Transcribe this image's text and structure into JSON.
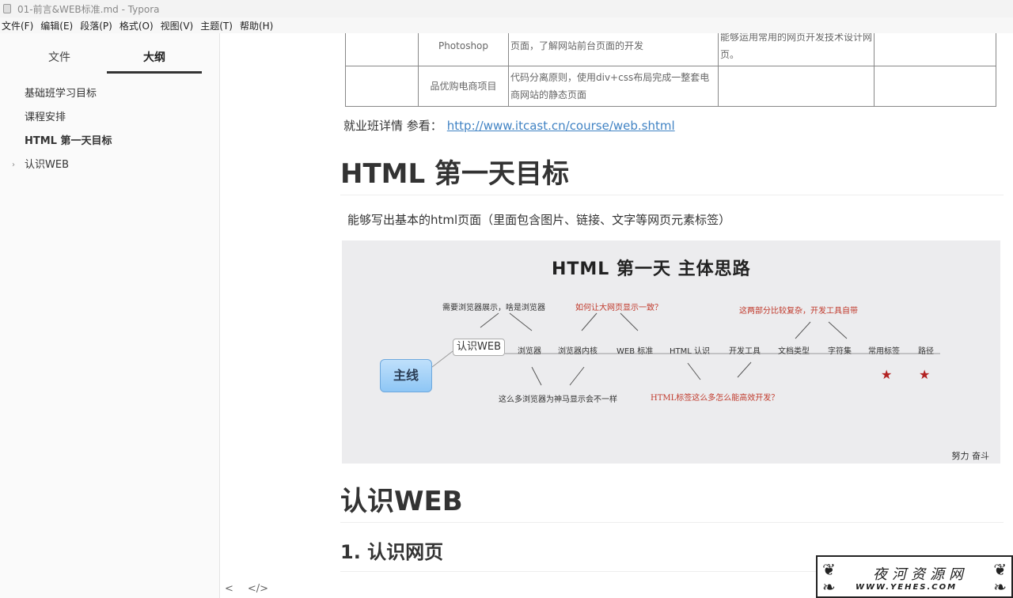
{
  "window": {
    "title": "01-前言&WEB标准.md - Typora"
  },
  "menu": [
    "文件(F)",
    "编辑(E)",
    "段落(P)",
    "格式(O)",
    "视图(V)",
    "主题(T)",
    "帮助(H)"
  ],
  "sidebar": {
    "tabs": [
      {
        "label": "文件"
      },
      {
        "label": "大纲"
      }
    ],
    "outline": [
      {
        "label": "基础班学习目标"
      },
      {
        "label": "课程安排"
      },
      {
        "label": "HTML 第一天目标"
      },
      {
        "label": "认识WEB"
      }
    ],
    "footer": {
      "back": "<",
      "source": "</>"
    }
  },
  "doc": {
    "table": {
      "rows": [
        [
          "",
          "Photoshop",
          "页面，了解网站前台页面的开发",
          "能够运用常用的网页开发技术设计网页。",
          ""
        ],
        [
          "",
          "品优购电商项目",
          "代码分离原则，使用div+css布局完成一整套电商网站的静态页面",
          "",
          ""
        ]
      ]
    },
    "link_prefix": "就业班详情 参看：",
    "link_url": "http://www.itcast.cn/course/web.shtml",
    "h1_day": "HTML 第一天目标",
    "para": "能够写出基本的html页面（里面包含图片、链接、文字等网页元素标签）",
    "mindmap": {
      "title": "HTML  第一天  主体思路",
      "root": "主线",
      "web": "认识WEB",
      "nodes": [
        "浏览器",
        "浏览器内核",
        "WEB 标准",
        "HTML 认识",
        "开发工具",
        "文档类型",
        "字符集",
        "常用标签",
        "路径"
      ],
      "notes": {
        "browser_question": "需要浏览器展示，啥是浏览器",
        "consistency": "如何让大网页显示一致？",
        "different": "这么多浏览器为神马显示会不一样",
        "complex": "这两部分比较复杂，开发工具自带",
        "efficient": "HTML标签这么多怎么能高效开发？"
      },
      "motto": "努力 奋斗"
    },
    "h1_web": "认识WEB",
    "h2_page": "1. 认识网页"
  },
  "watermark": {
    "cn": "夜河资源网",
    "en": "WWW.YEHES.COM"
  }
}
